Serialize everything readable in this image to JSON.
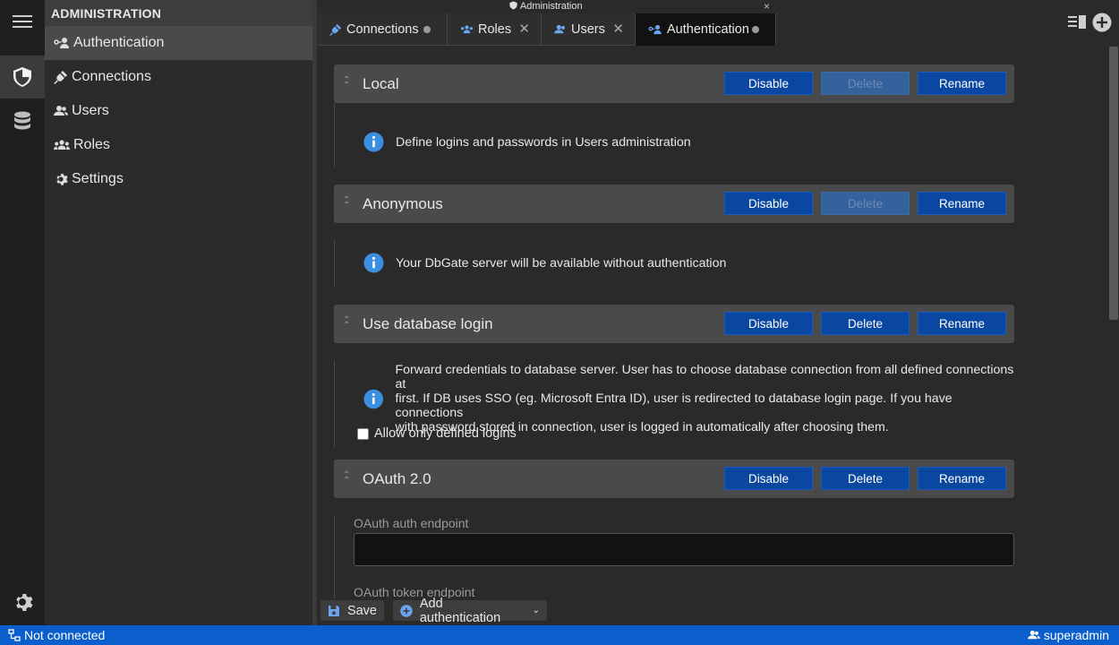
{
  "window": {
    "title": "Administration"
  },
  "sidebar": {
    "title": "ADMINISTRATION",
    "items": [
      {
        "label": "Authentication",
        "icon": "key-user-icon",
        "active": true
      },
      {
        "label": "Connections",
        "icon": "plug-icon"
      },
      {
        "label": "Users",
        "icon": "users-icon"
      },
      {
        "label": "Roles",
        "icon": "roles-icon"
      },
      {
        "label": "Settings",
        "icon": "gear-icon"
      }
    ]
  },
  "tabs": [
    {
      "label": "Connections",
      "icon": "plug-icon",
      "state": "modified"
    },
    {
      "label": "Roles",
      "icon": "roles-icon",
      "state": "close"
    },
    {
      "label": "Users",
      "icon": "users-icon",
      "state": "close"
    },
    {
      "label": "Authentication",
      "icon": "key-user-icon",
      "state": "modified",
      "active": true
    }
  ],
  "buttons": {
    "disable": "Disable",
    "delete": "Delete",
    "rename": "Rename"
  },
  "sections": [
    {
      "title": "Local",
      "info": "Define logins and passwords in Users administration",
      "delete_enabled": false
    },
    {
      "title": "Anonymous",
      "info": "Your DbGate server will be available without authentication",
      "delete_enabled": false
    },
    {
      "title": "Use database login",
      "info_lines": [
        "Forward credentials to database server. User has to choose database connection from all defined connections at",
        "first. If DB uses SSO (eg. Microsoft Entra ID), user is redirected to database login page. If you have connections",
        "with password stored in connection, user is logged in automatically after choosing them."
      ],
      "checkbox": {
        "label": "Allow only defined logins",
        "checked": false
      },
      "delete_enabled": true
    },
    {
      "title": "OAuth 2.0",
      "fields": [
        {
          "label": "OAuth auth endpoint",
          "value": ""
        },
        {
          "label": "OAuth token endpoint",
          "value": ""
        }
      ],
      "delete_enabled": true
    }
  ],
  "toolbar": {
    "save": "Save",
    "add_auth": "Add authentication"
  },
  "status": {
    "connection": "Not connected",
    "user": "superadmin"
  },
  "colors": {
    "accent": "#0a47a0",
    "statusbar": "#0a5fcc",
    "info": "#3b8fe0"
  }
}
